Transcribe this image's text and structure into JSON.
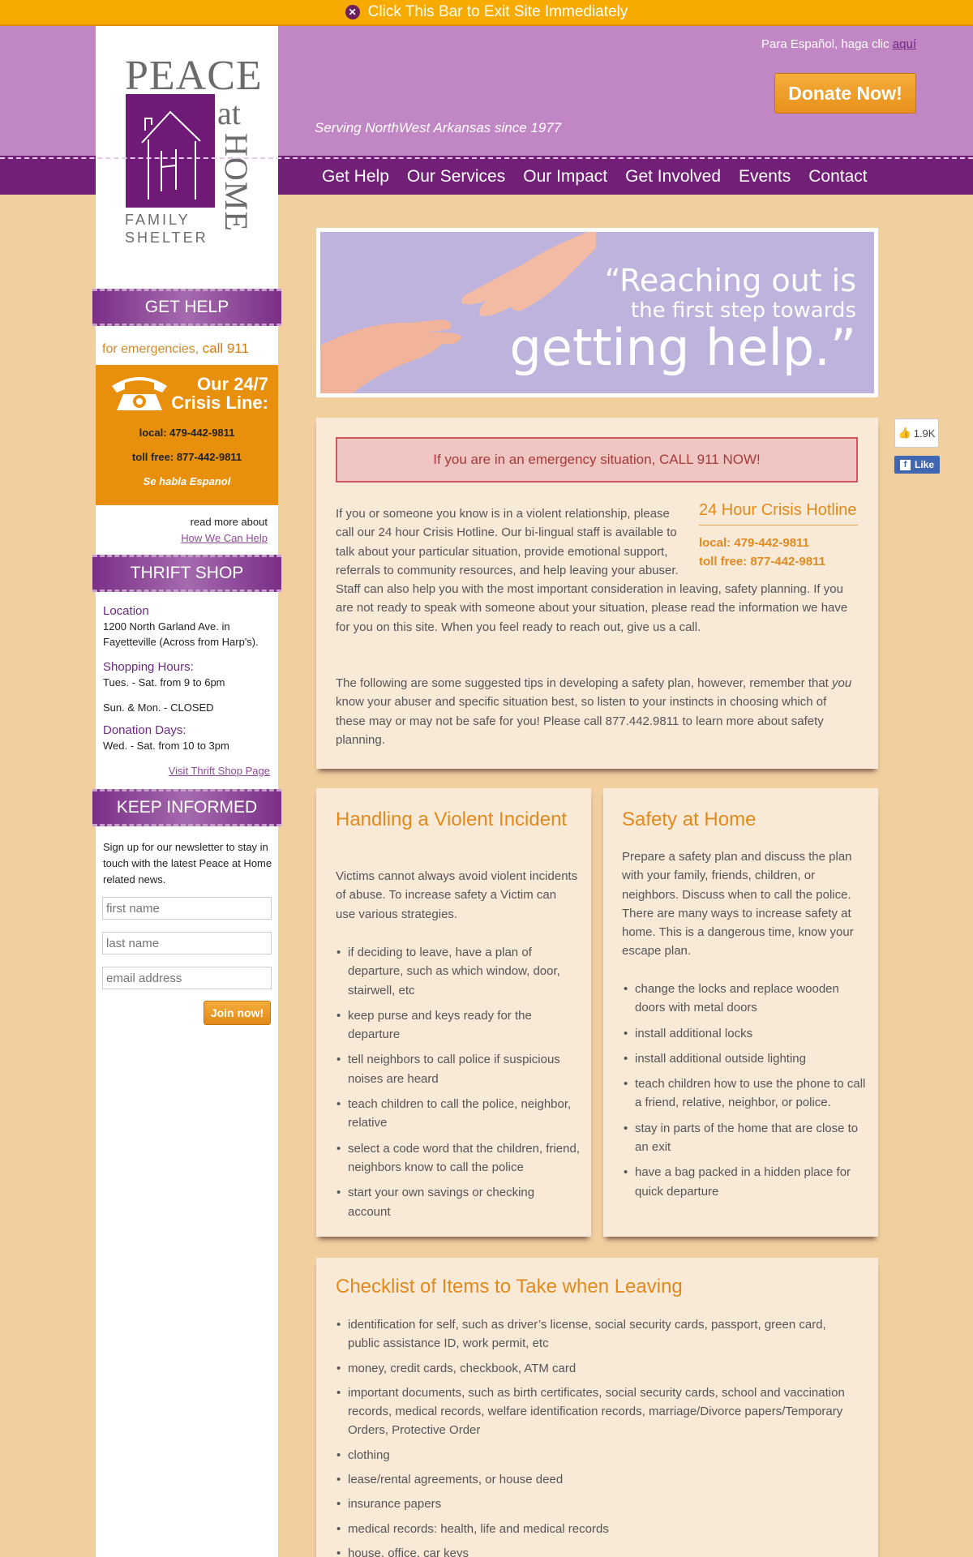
{
  "exit_bar": {
    "label": "Click This Bar to Exit Site Immediately"
  },
  "header": {
    "espanol_text": "Para Español, haga clic",
    "espanol_link": "aquí",
    "donate_label": "Donate Now!",
    "tagline": "Serving NorthWest Arkansas since 1977"
  },
  "nav": {
    "items": [
      "Get Help",
      "Our Services",
      "Our Impact",
      "Get Involved",
      "Events",
      "Contact"
    ]
  },
  "logo": {
    "peace": "PEACE",
    "at": "at",
    "home": "HOME",
    "family": "FAMILY",
    "shelter": "SHELTER"
  },
  "sidebar": {
    "get_help": {
      "heading": "GET HELP",
      "emergency_prefix": "for emergencies,",
      "emergency_call": "call 911",
      "crisis_title": "Our 24/7 Crisis Line:",
      "local": "local: 479-442-9811",
      "toll_free": "toll free: 877-442-9811",
      "espanol": "Se habla Espanol",
      "read_more": "read more about",
      "read_more_link": "How We Can Help"
    },
    "thrift": {
      "heading": "THRIFT SHOP",
      "location_label": "Location",
      "location": "1200 North Garland Ave. in Fayetteville (Across from Harp's).",
      "hours_label": "Shopping Hours:",
      "hours": "Tues. - Sat. from 9 to 6pm",
      "closed": "Sun. & Mon. - CLOSED",
      "donation_label": "Donation Days:",
      "donation": "Wed. - Sat. from 10 to 3pm",
      "visit_link": "Visit Thrift Shop Page"
    },
    "keep_informed": {
      "heading": "KEEP INFORMED",
      "text": "Sign up for our newsletter to stay in touch with the latest Peace at Home related news.",
      "first_name_placeholder": "first name",
      "last_name_placeholder": "last name",
      "email_placeholder": "email address",
      "join_label": "Join now!"
    }
  },
  "banner": {
    "line1": "“Reaching out is",
    "line2": "the first step towards",
    "line3": "getting help.”"
  },
  "social": {
    "like_count": "1.9K",
    "like_label": "Like"
  },
  "main": {
    "alert": "If you are in an emergency situation, CALL 911 NOW!",
    "hotline_title": "24 Hour Crisis Hotline",
    "hotline_local": "local: 479-442-9811",
    "hotline_toll": "toll free: 877-442-9811",
    "intro": "If you or someone you know is in a violent relationship, please call our 24 hour Crisis Hotline. Our bi-lingual staff is available to talk about your particular situation, provide emotional support, referrals to community resources, and help leaving your abuser. Staff can also help you with the most important consideration in leaving, safety planning. If you are not ready to speak with someone about your situation, please read the information we have for you on this site. When you feel ready to reach out, give us a call.",
    "tips_a": "The following are some suggested tips in developing a safety plan, however, remember that",
    "tips_em": "you",
    "tips_b": "know your abuser and specific situation best, so listen to your instincts in choosing which of these may or may not be safe for you! Please call 877.442.9811 to learn more about safety planning."
  },
  "violent": {
    "title": "Handling a Violent Incident",
    "text": "Victims cannot always avoid violent incidents of abuse. To increase safety a Victim can use various strategies.",
    "items": [
      "if deciding to leave, have a plan of departure, such as which window, door, stairwell, etc",
      "keep purse and keys ready for the departure",
      "tell neighbors to call police if suspicious noises are heard",
      "teach children to call the police, neighbor, relative",
      "select a code word that the children, friend, neighbors know to call the police",
      "start your own savings or checking account"
    ]
  },
  "home": {
    "title": "Safety at Home",
    "text": "Prepare a safety plan and discuss the plan with your family, friends, children, or neighbors. Discuss when to call the police. There are many ways to increase safety at home. This is a dangerous time, know your escape plan.",
    "items": [
      "change the locks and replace wooden doors with metal doors",
      "install additional locks",
      "install additional outside lighting",
      "teach children how to use the phone to call a friend, relative, neighbor, or police.",
      "stay in parts of the home that are close to an exit",
      "have a bag packed in a hidden place for quick departure"
    ]
  },
  "checklist": {
    "title": "Checklist of Items to Take when Leaving",
    "items": [
      "identification for self, such as driver’s license, social security cards, passport, green card, public assistance ID, work permit, etc",
      "money, credit cards, checkbook, ATM card",
      "important documents, such as birth certificates, social security cards, school and vaccination records, medical records, welfare identification records, marriage/Divorce papers/Temporary Orders, Protective Order",
      "clothing",
      "lease/rental agreements, or house deed",
      "insurance papers",
      "medical records: health, life and medical records",
      "house, office, car keys"
    ]
  },
  "colors": {
    "accent": "#e08a1e",
    "purple": "#721f78",
    "header": "#c186c4",
    "exit_bar": "#f7ab00"
  }
}
